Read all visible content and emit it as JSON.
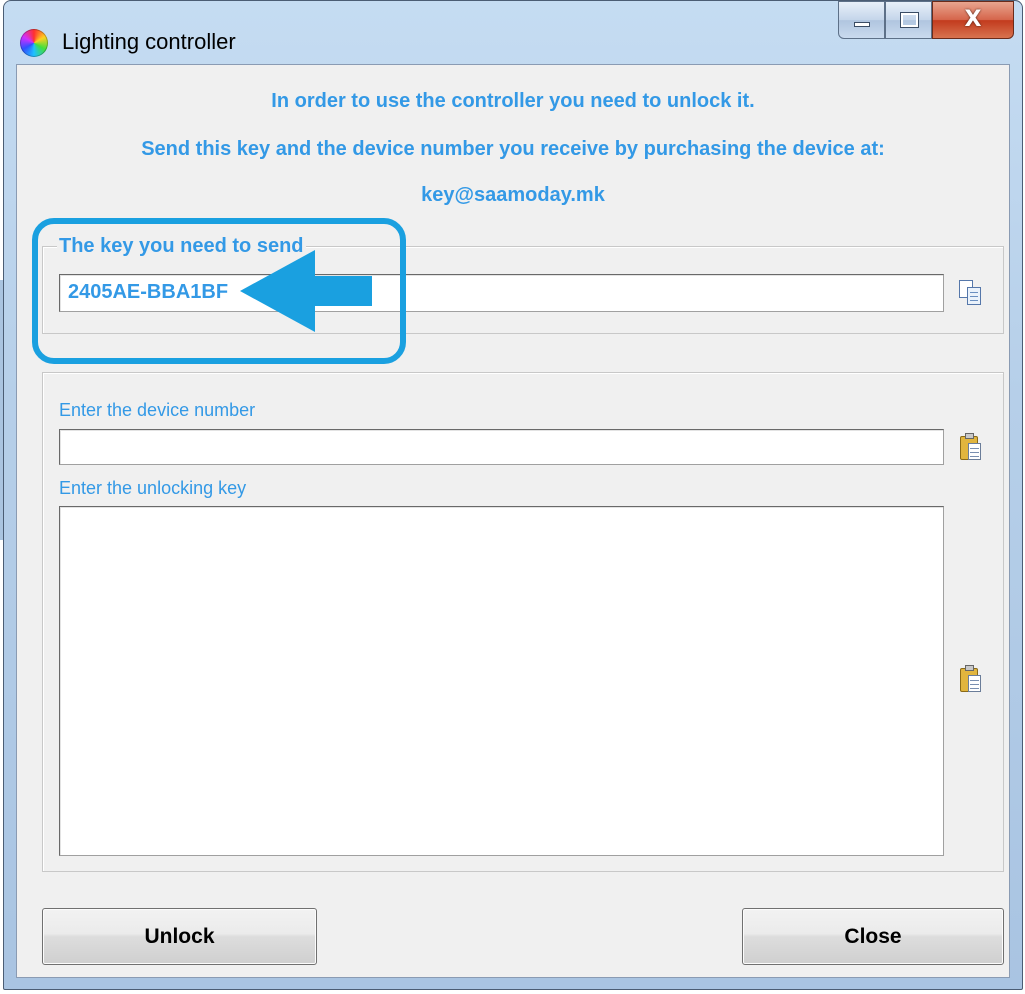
{
  "window": {
    "title": "Lighting controller",
    "caption_buttons": {
      "minimize": "minimize",
      "maximize": "maximize",
      "close": "X"
    }
  },
  "info": {
    "line1": "In order to use the controller you need to unlock it.",
    "line2": "Send this key and the device number you receive by purchasing the device at:",
    "email": "key@saamoday.mk"
  },
  "key_group": {
    "legend": "The key you need to send",
    "key_value": "2405AE-BBA1BF"
  },
  "unlock_group": {
    "device_label": "Enter the device number",
    "device_value": "",
    "unlock_label": "Enter the unlocking key",
    "unlock_value": ""
  },
  "buttons": {
    "unlock": "Unlock",
    "close": "Close"
  },
  "icons": {
    "copy": "copy-icon",
    "paste": "paste-icon",
    "app": "color-wheel-icon"
  },
  "colors": {
    "accent_text": "#3399e6",
    "annotation": "#1aa0e0"
  }
}
